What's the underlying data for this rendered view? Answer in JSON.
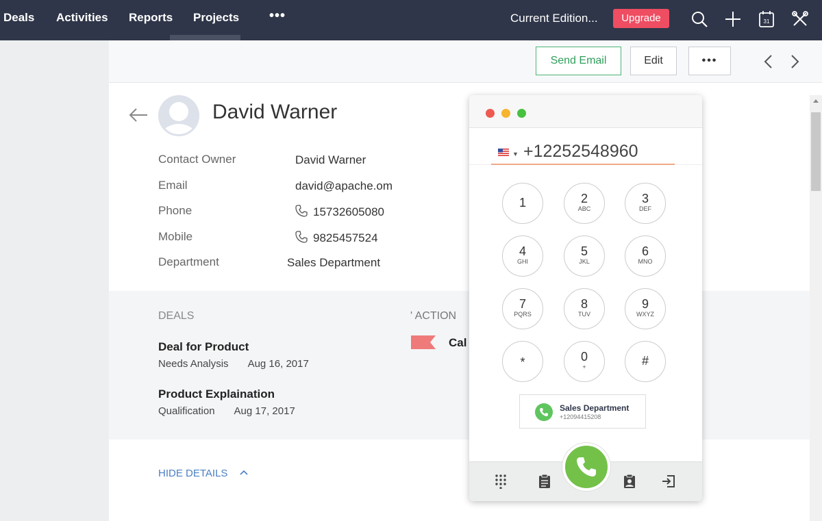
{
  "nav": {
    "items": [
      "Deals",
      "Activities",
      "Reports",
      "Projects"
    ],
    "more": "•••",
    "edition": "Current Edition...",
    "upgrade": "Upgrade",
    "icons": [
      "search-icon",
      "plus-icon",
      "calendar-icon",
      "tools-icon"
    ],
    "calendar_day": "31"
  },
  "toolbar": {
    "send_email": "Send Email",
    "edit": "Edit",
    "more": "•••"
  },
  "contact": {
    "name": "David Warner",
    "fields": [
      {
        "label": "Contact Owner",
        "value": "David Warner"
      },
      {
        "label": "Email",
        "value": "david@apache.om"
      },
      {
        "label": "Phone",
        "value": "15732605080"
      },
      {
        "label": "Mobile",
        "value": "9825457524"
      },
      {
        "label": "Department",
        "value": "Sales Department"
      }
    ]
  },
  "deals": {
    "title": "DEALS",
    "items": [
      {
        "name": "Deal for Product",
        "stage": "Needs Analysis",
        "date": "Aug 16, 2017"
      },
      {
        "name": "Product Explaination",
        "stage": "Qualification",
        "date": "Aug 17, 2017"
      }
    ]
  },
  "action": {
    "title": "' ACTION",
    "item": "Cal"
  },
  "hide_details": "HIDE DETAILS",
  "dialer": {
    "number": "+12252548960",
    "keys": [
      {
        "digit": "1",
        "letters": ""
      },
      {
        "digit": "2",
        "letters": "ABC"
      },
      {
        "digit": "3",
        "letters": "DEF"
      },
      {
        "digit": "4",
        "letters": "GHI"
      },
      {
        "digit": "5",
        "letters": "JKL"
      },
      {
        "digit": "6",
        "letters": "MNO"
      },
      {
        "digit": "7",
        "letters": "PQRS"
      },
      {
        "digit": "8",
        "letters": "TUV"
      },
      {
        "digit": "9",
        "letters": "WXYZ"
      },
      {
        "digit": "*",
        "letters": ""
      },
      {
        "digit": "0",
        "letters": "+"
      },
      {
        "digit": "#",
        "letters": ""
      }
    ],
    "caller": {
      "name": "Sales Department",
      "number": "+12094415208"
    },
    "colors": {
      "close": "#ee5a52",
      "minimize": "#f5b52d",
      "maximize": "#47c141",
      "call": "#74c14a"
    }
  }
}
